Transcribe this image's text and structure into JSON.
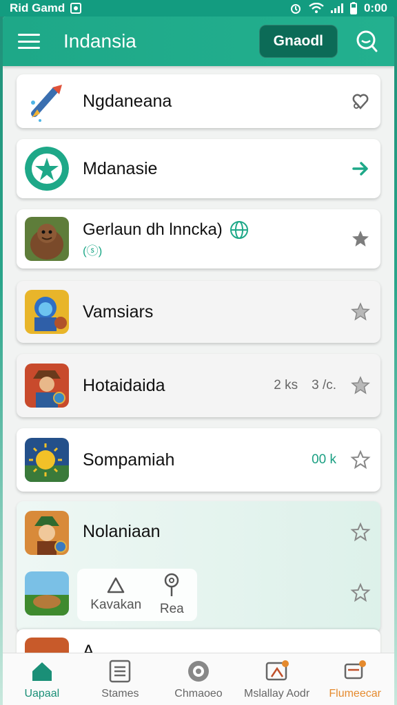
{
  "status": {
    "carrier": "Rid Gamd",
    "time": "0:00"
  },
  "appbar": {
    "title": "Indansia",
    "button_label": "Gnaodl"
  },
  "cards": [
    {
      "label": "Ngdaneana",
      "right_meta": [],
      "icon": "rocket-icon",
      "action_icon": "heart-icon"
    },
    {
      "label": "Mdanasie",
      "right_meta": [],
      "icon": "star-badge-icon",
      "action_icon": "arrow-right-icon"
    },
    {
      "label": "Gerlaun dh lnncka)",
      "sublabel": "(ⓢ)",
      "right_meta": [],
      "icon": "ogre-game-icon",
      "action_icon": "star-icon"
    },
    {
      "label": "Vamsiars",
      "right_meta": [],
      "icon": "hero-game-icon",
      "action_icon": "star-outline-icon"
    },
    {
      "label": "Hotaidaida",
      "right_meta": [
        "2 ks",
        "3 /c."
      ],
      "icon": "warrior-game-icon",
      "action_icon": "star-outline-icon"
    },
    {
      "label": "Sompamiah",
      "right_meta": [
        "00 k"
      ],
      "icon": "sun-game-icon",
      "action_icon": "star-outline-icon"
    }
  ],
  "expanded": {
    "label": "Nolaniaan",
    "sub_items": [
      {
        "label": "Kavakan"
      },
      {
        "label": "Rea"
      }
    ]
  },
  "peek_label": "A ...",
  "bottom_nav": [
    {
      "label": "Uapaal",
      "icon": "home-icon"
    },
    {
      "label": "Stames",
      "icon": "list-icon"
    },
    {
      "label": "Chmaoeo",
      "icon": "disc-icon"
    },
    {
      "label": "Mslallay Aodr",
      "icon": "photo-badge-icon"
    },
    {
      "label": "Flumeecar",
      "icon": "cart-badge-icon"
    }
  ],
  "colors": {
    "accent": "#1ea888",
    "dark_button": "#0c6b57",
    "warn": "#e58a2d"
  }
}
